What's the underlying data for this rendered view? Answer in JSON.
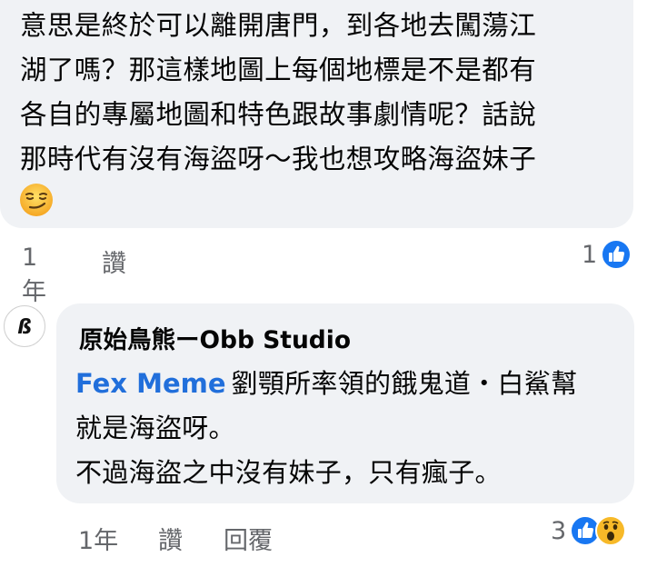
{
  "comment1": {
    "lines": [
      "意思是終於可以離開唐門，到各地去闖蕩江",
      "湖了嗎？那這樣地圖上每個地標是不是都有",
      "各自的專屬地圖和特色跟故事劇情呢？話說",
      "那時代有沒有海盜呀～我也想攻略海盜妹子"
    ],
    "emoji": "smirking-face",
    "time": "1年",
    "like_label": "讚",
    "reaction_count": "1",
    "reactions": [
      "like"
    ]
  },
  "reply": {
    "author": "原始鳥熊ーObb Studio",
    "mention": "Fex Meme",
    "line1_rest": "劉顎所率領的餓鬼道・白鯊幫",
    "line2": "就是海盜呀。",
    "line3": "不過海盜之中沒有妹子，只有瘋子。",
    "time": "1年",
    "like_label": "讚",
    "reply_label": "回覆",
    "reaction_count": "3",
    "reactions": [
      "like",
      "wow"
    ]
  },
  "colors": {
    "bubble": "#f0f2f5",
    "text": "#050505",
    "meta": "#65676b",
    "mention": "#216fdb",
    "like_blue": "#1877f2",
    "wow_yellow": "#f7b928"
  }
}
